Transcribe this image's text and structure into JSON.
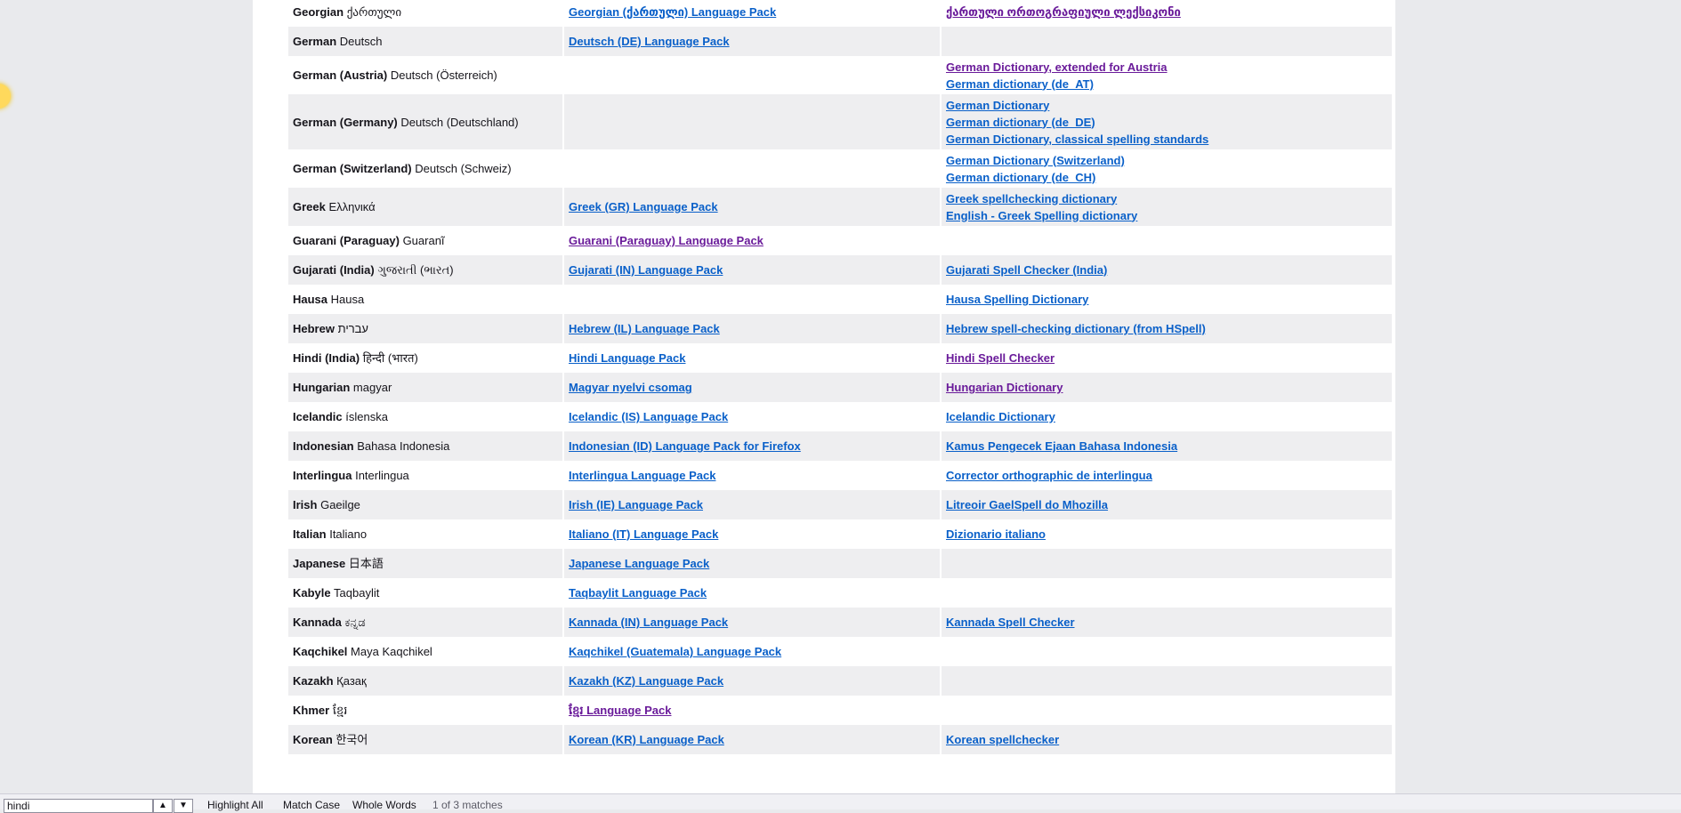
{
  "rows": [
    {
      "name": "Georgian",
      "native": "ქართული",
      "packs": [
        "Georgian (ქართული) Language Pack"
      ],
      "dicts": [
        "ქართული ორთოგრაფიული ლექსიკონი"
      ],
      "h": "even"
    },
    {
      "name": "German",
      "native": "Deutsch",
      "packs": [
        "Deutsch (DE) Language Pack"
      ],
      "dicts": [],
      "h": "odd"
    },
    {
      "name": "German (Austria)",
      "native": "Deutsch (Österreich)",
      "packs": [],
      "dicts": [
        "German Dictionary, extended for Austria",
        "German dictionary (de_AT)"
      ],
      "h": "even h2"
    },
    {
      "name": "German (Germany)",
      "native": "Deutsch (Deutschland)",
      "packs": [],
      "dicts": [
        "German Dictionary",
        "German dictionary (de_DE)",
        "German Dictionary, classical spelling standards"
      ],
      "h": "odd h3"
    },
    {
      "name": "German (Switzerland)",
      "native": "Deutsch (Schweiz)",
      "packs": [],
      "dicts": [
        "German Dictionary (Switzerland)",
        "German dictionary (de_CH)"
      ],
      "h": "even h2"
    },
    {
      "name": "Greek",
      "native": "Ελληνικά",
      "packs": [
        "Greek (GR) Language Pack"
      ],
      "dicts": [
        "Greek spellchecking dictionary",
        "English - Greek Spelling dictionary"
      ],
      "h": "odd h2b"
    },
    {
      "name": "Guarani (Paraguay)",
      "native": "Guaranĩ",
      "packs": [
        "Guarani (Paraguay) Language Pack"
      ],
      "dicts": [],
      "h": "even",
      "visited": [
        true
      ]
    },
    {
      "name": "Gujarati (India)",
      "native": "ગુજરાતી (ભારત)",
      "packs": [
        "Gujarati (IN) Language Pack"
      ],
      "dicts": [
        "Gujarati Spell Checker (India)"
      ],
      "h": "odd"
    },
    {
      "name": "Hausa",
      "native": "Hausa",
      "packs": [],
      "dicts": [
        "Hausa Spelling Dictionary"
      ],
      "h": "even"
    },
    {
      "name": "Hebrew",
      "native": "עברית",
      "packs": [
        "Hebrew (IL) Language Pack"
      ],
      "dicts": [
        "Hebrew spell-checking dictionary (from HSpell)"
      ],
      "h": "odd"
    },
    {
      "name": "Hindi (India)",
      "native": "हिन्दी (भारत)",
      "packs": [
        "Hindi Language Pack"
      ],
      "dicts": [
        "Hindi Spell Checker"
      ],
      "h": "even",
      "dvisited": true
    },
    {
      "name": "Hungarian",
      "native": "magyar",
      "packs": [
        "Magyar nyelvi csomag"
      ],
      "dicts": [
        "Hungarian Dictionary"
      ],
      "h": "odd",
      "dvisited": true
    },
    {
      "name": "Icelandic",
      "native": "íslenska",
      "packs": [
        "Icelandic (IS) Language Pack"
      ],
      "dicts": [
        "Icelandic Dictionary"
      ],
      "h": "even"
    },
    {
      "name": "Indonesian",
      "native": "Bahasa Indonesia",
      "packs": [
        "Indonesian (ID) Language Pack for Firefox"
      ],
      "dicts": [
        "Kamus Pengecek Ejaan Bahasa Indonesia"
      ],
      "h": "odd"
    },
    {
      "name": "Interlingua",
      "native": "Interlingua",
      "packs": [
        "Interlingua Language Pack"
      ],
      "dicts": [
        "Corrector orthographic de interlingua"
      ],
      "h": "even"
    },
    {
      "name": "Irish",
      "native": "Gaeilge",
      "packs": [
        "Irish (IE) Language Pack"
      ],
      "dicts": [
        "Litreoir GaelSpell do Mhozilla"
      ],
      "h": "odd"
    },
    {
      "name": "Italian",
      "native": "Italiano",
      "packs": [
        "Italiano (IT) Language Pack"
      ],
      "dicts": [
        "Dizionario italiano"
      ],
      "h": "even"
    },
    {
      "name": "Japanese",
      "native": "日本語",
      "packs": [
        "Japanese Language Pack"
      ],
      "dicts": [],
      "h": "odd"
    },
    {
      "name": "Kabyle",
      "native": "Taqbaylit",
      "packs": [
        "Taqbaylit Language Pack"
      ],
      "dicts": [],
      "h": "even"
    },
    {
      "name": "Kannada",
      "native": "ಕನ್ನಡ",
      "packs": [
        "Kannada (IN) Language Pack"
      ],
      "dicts": [
        "Kannada Spell Checker"
      ],
      "h": "odd"
    },
    {
      "name": "Kaqchikel",
      "native": "Maya Kaqchikel",
      "packs": [
        "Kaqchikel (Guatemala) Language Pack"
      ],
      "dicts": [],
      "h": "even"
    },
    {
      "name": "Kazakh",
      "native": "Қазақ",
      "packs": [
        "Kazakh (KZ) Language Pack"
      ],
      "dicts": [],
      "h": "odd"
    },
    {
      "name": "Khmer",
      "native": "ខ្មែរ",
      "packs": [
        "ខ្មែរ Language Pack"
      ],
      "dicts": [],
      "h": "even",
      "visited": [
        true
      ]
    },
    {
      "name": "Korean",
      "native": "한국어",
      "packs": [
        "Korean (KR) Language Pack"
      ],
      "dicts": [
        "Korean spellchecker"
      ],
      "h": "odd"
    }
  ],
  "findbar": {
    "query": "hindi",
    "prev": "▲",
    "next": "▼",
    "highlight_all": "Highlight All",
    "match_case": "Match Case",
    "whole_words": "Whole Words",
    "status": "1 of 3 matches"
  },
  "colors": {
    "link": "#0a60c9",
    "visited": "#6a1b9a",
    "row_alt": "#eeeef0",
    "background": "#e9eaed"
  }
}
